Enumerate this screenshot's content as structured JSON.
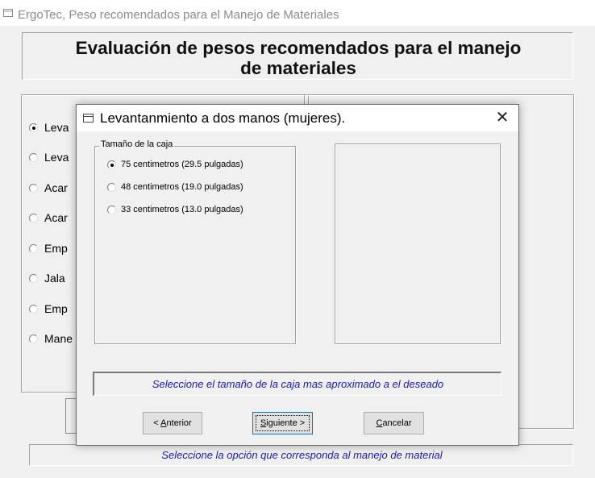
{
  "main_window": {
    "title": "ErgoTec, Peso recomendados para el Manejo de Materiales",
    "heading_line1": "Evaluación de pesos recomendados para el manejo",
    "heading_line2": "de materiales",
    "options": [
      {
        "label": "Leva",
        "selected": true
      },
      {
        "label": "Leva",
        "selected": false
      },
      {
        "label": "Acar",
        "selected": false
      },
      {
        "label": "Acar",
        "selected": false
      },
      {
        "label": "Emp",
        "selected": false
      },
      {
        "label": "Jala",
        "selected": false
      },
      {
        "label": "Emp",
        "selected": false
      },
      {
        "label": "Mane",
        "selected": false
      }
    ],
    "status_text": "Seleccione la opción que corresponda al manejo de material"
  },
  "dialog": {
    "title": "Levantanmiento a dos manos (mujeres).",
    "close_icon": "close-icon",
    "group_label": "Tamaño de la caja",
    "options": [
      {
        "label": "75 centimetros (29.5 pulgadas)",
        "selected": true
      },
      {
        "label": "48 centimetros (19.0 pulgadas)",
        "selected": false
      },
      {
        "label": "33 centimetros (13.0 pulgadas)",
        "selected": false
      }
    ],
    "status_text": "Seleccione el tamaño de la caja mas aproximado a el deseado",
    "buttons": {
      "back_prefix": "< ",
      "back_mnemonic": "A",
      "back_rest": "nterior",
      "next_mnemonic": "S",
      "next_rest": "iguiente >",
      "cancel_mnemonic": "C",
      "cancel_rest": "ancelar"
    }
  },
  "colors": {
    "status_text": "#1a1ab0",
    "client_bg": "#f0f0f0",
    "focus_border": "#0078d7"
  }
}
